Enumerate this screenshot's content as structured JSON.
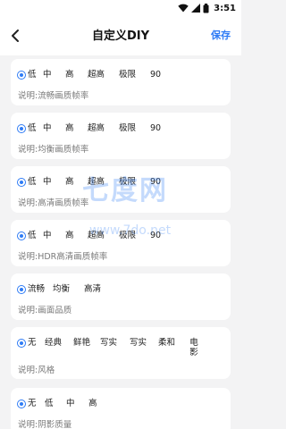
{
  "status_bar": {
    "time": "3:51"
  },
  "header": {
    "title": "自定义DIY",
    "save_label": "保存"
  },
  "cards": [
    {
      "options": [
        "低",
        "中",
        "高",
        "超高",
        "极限",
        "90"
      ],
      "selected": 0,
      "description": "说明:流畅画质帧率"
    },
    {
      "options": [
        "低",
        "中",
        "高",
        "超高",
        "极限",
        "90"
      ],
      "selected": 0,
      "description": "说明:均衡画质帧率"
    },
    {
      "options": [
        "低",
        "中",
        "高",
        "超高",
        "极限",
        "90"
      ],
      "selected": 0,
      "description": "说明:高清画质帧率"
    },
    {
      "options": [
        "低",
        "中",
        "高",
        "超高",
        "极限",
        "90"
      ],
      "selected": 0,
      "description": "说明:HDR高清画质帧率"
    },
    {
      "options": [
        "流畅",
        "均衡",
        "高清"
      ],
      "selected": 0,
      "description": "说明:画面品质"
    },
    {
      "options": [
        "无",
        "经典",
        "鲜艳",
        "写实",
        "写实",
        "柔和",
        "电影"
      ],
      "selected": 0,
      "description": "说明:风格"
    },
    {
      "options": [
        "无",
        "低",
        "中",
        "高"
      ],
      "selected": 0,
      "description": "说明:阴影质量"
    }
  ],
  "watermark": {
    "logo": "七度网",
    "url": "www.7do.net"
  },
  "colors": {
    "accent": "#2f7cf6",
    "background": "#f3f3f4",
    "card": "#ffffff"
  }
}
